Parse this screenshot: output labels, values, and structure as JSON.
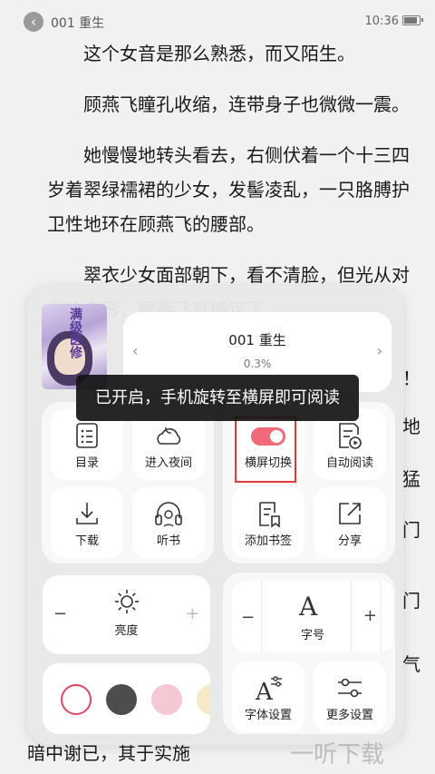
{
  "status_bar": {
    "chapter_title": "001 重生",
    "time": "10:36"
  },
  "content": {
    "paragraphs": [
      "这个女音是那么熟悉，而又陌生。",
      "顾燕飞瞳孔收缩，连带身子也微微一震。",
      "她慢慢地转头看去，右侧伏着一个十三四岁着翠绿襦裙的少女，发髻凌乱，一只胳膊护卫性地环在顾燕飞的腰部。",
      "翠衣少女面部朝下，看不清脸，但光从对方的身形，顾燕飞就确定了。"
    ],
    "side_fragments": [
      "！",
      "地",
      "猛",
      "门",
      "门",
      "气"
    ],
    "bottom_line": "暗中谢已，其于实施"
  },
  "cover": {
    "title": "满级医修"
  },
  "chapter_card": {
    "name": "001 重生",
    "progress": "0.3%",
    "prev": "‹",
    "next": "›"
  },
  "tooltip": "已开启，手机旋转至横屏即可阅读",
  "menu": {
    "toc": "目录",
    "night": "进入夜间",
    "landscape": "横屏切换",
    "auto_read": "自动阅读",
    "download": "下载",
    "listen": "听书",
    "bookmark": "添加书签",
    "share": "分享",
    "brightness": "亮度",
    "font_size": "字号",
    "font_settings": "字体设置",
    "more_settings": "更多设置"
  },
  "landscape_toggle": {
    "enabled": true,
    "color": "#f06a7a"
  },
  "bg_colors": [
    "#ffffff",
    "#4d4d4d",
    "#f6c8d4",
    "#f5e9c8"
  ],
  "watermark": "一听下载"
}
